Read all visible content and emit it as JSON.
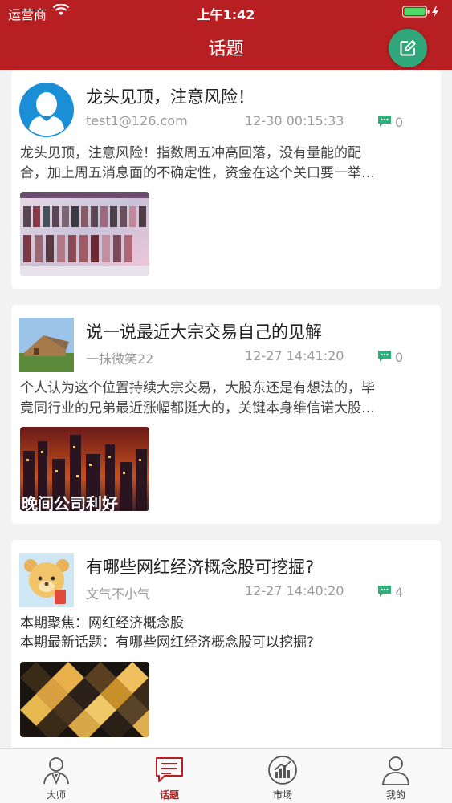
{
  "status_bar": {
    "carrier": "运营商",
    "time": "上午1:42"
  },
  "nav": {
    "title": "话题"
  },
  "posts": [
    {
      "title": "龙头见顶，注意风险！",
      "author": "test1@126.com",
      "time": "12-30 00:15:33",
      "comment_count": "0",
      "body_lines": [
        "龙头见顶，注意风险！指数周五冲高回落，没有量能的配",
        "合，加上周五消息面的不确定性，资金在这个关口要一举…"
      ]
    },
    {
      "title": "说一说最近大宗交易自己的见解",
      "author": "一抹微笑22",
      "time": "12-27 14:41:20",
      "comment_count": "0",
      "body_lines": [
        "个人认为这个位置持续大宗交易，大股东还是有想法的，毕",
        "竟同行业的兄弟最近涨幅都挺大的，关键本身维信诺大股…"
      ],
      "image_caption": "晚间公司利好"
    },
    {
      "title": "有哪些网红经济概念股可挖掘?",
      "author": "文气不小气",
      "time": "12-27 14:40:20",
      "comment_count": "4",
      "body_lines": [
        "本期聚焦：网红经济概念股",
        "本期最新话题：有哪些网红经济概念股可以挖掘?"
      ]
    }
  ],
  "tabs": [
    {
      "label": "大师",
      "icon": "master-icon",
      "active": false
    },
    {
      "label": "话题",
      "icon": "topic-icon",
      "active": true
    },
    {
      "label": "市场",
      "icon": "market-icon",
      "active": false
    },
    {
      "label": "我的",
      "icon": "profile-icon",
      "active": false
    }
  ],
  "colors": {
    "brand_red": "#b81f23",
    "compose_green": "#2fa77a",
    "comment_green": "#2fb07a"
  }
}
